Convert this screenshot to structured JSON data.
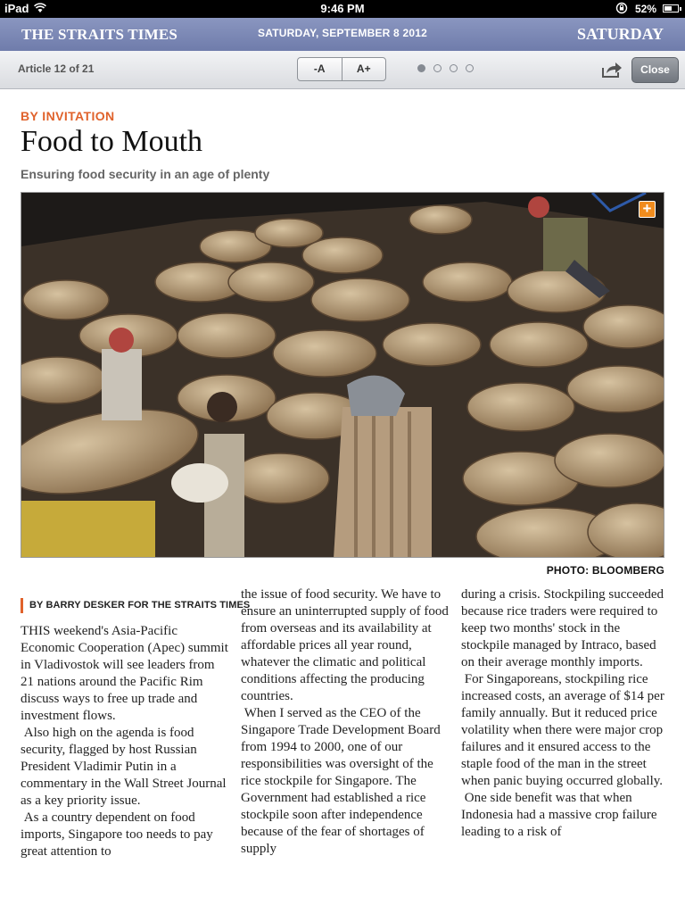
{
  "status_bar": {
    "device": "iPad",
    "time": "9:46 PM",
    "battery": "52%"
  },
  "masthead": {
    "brand": "THE STRAITS TIMES",
    "date": "SATURDAY, SEPTEMBER 8 2012",
    "day": "SATURDAY"
  },
  "toolbar": {
    "article_counter": "Article 12 of 21",
    "font_decrease": "-A",
    "font_increase": "A+",
    "page_indicator": {
      "total": 4,
      "current": 1
    },
    "close_label": "Close"
  },
  "article": {
    "kicker": "BY INVITATION",
    "headline": "Food to Mouth",
    "standfirst": "Ensuring food security in an age of plenty",
    "photo_credit": "PHOTO: BLOOMBERG",
    "byline": "BY BARRY DESKER FOR THE STRAITS TIMES",
    "col1": [
      "THIS weekend's Asia-Pacific Economic Cooperation (Apec) summit in Vladivostok will see leaders from 21 nations around the Pacific Rim discuss ways to free up trade and investment flows.",
      " Also high on the agenda is food security, flagged by host Russian President Vladimir Putin in a commentary in the Wall Street Journal as a key priority issue.",
      " As a country dependent on food imports, Singapore too needs to pay great attention to"
    ],
    "col2": [
      "the issue of food security. We have to ensure an uninterrupted supply of food from overseas and its availability at affordable prices all year round, whatever the climatic and political conditions affecting the producing countries.",
      " When I served as the CEO of the Singapore Trade Development Board from 1994 to 2000, one of our responsibilities was oversight of the rice stockpile for Singapore. The Government had established a rice stockpile soon after independence because of the fear of shortages of supply"
    ],
    "col3": [
      "during a crisis. Stockpiling succeeded because rice traders were required to keep two months' stock in the stockpile managed by Intraco, based on their average monthly imports.",
      " For Singaporeans, stockpiling rice increased costs, an average of $14 per family annually. But it reduced price volatility when there were major crop failures and it ensured access to the staple food of the man in the street when panic buying occurred globally.",
      " One side benefit was that when Indonesia had a massive crop failure leading to a risk of"
    ]
  },
  "colors": {
    "accent": "#e0622b",
    "masthead": "#7b87b5",
    "expand_badge": "#f08c1e"
  }
}
